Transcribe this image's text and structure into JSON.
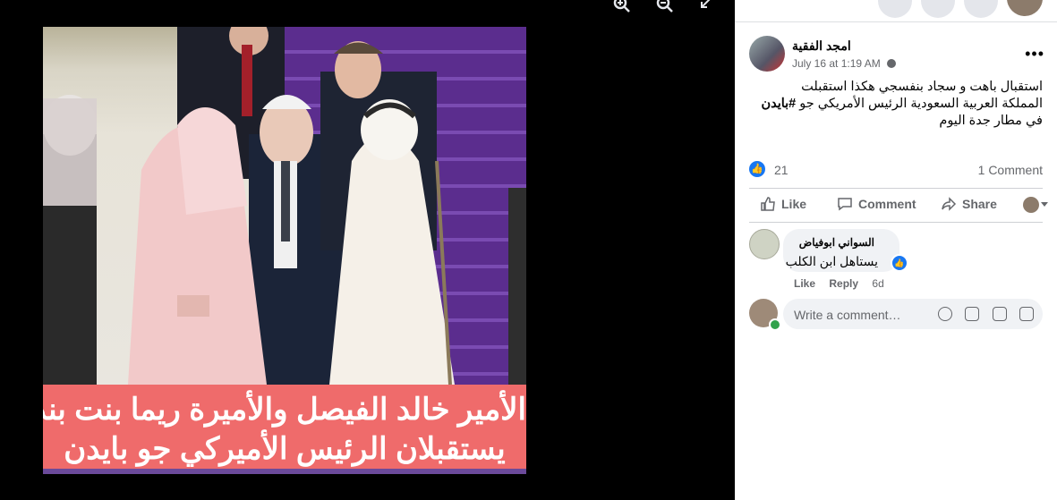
{
  "viewer": {
    "caption_line1": "الأمير خالد الفيصل والأميرة ريما بنت بندر",
    "caption_line2": "يستقبلان الرئيس الأميركي جو بايدن",
    "icons": [
      "zoom-in-icon",
      "zoom-out-icon",
      "expand-icon"
    ]
  },
  "post": {
    "author": "امجد الفقية",
    "timestamp": "July 16 at 1:19 AM",
    "more": "•••",
    "text_line1": "استقبال باهت و سجاد بنفسجي هكذا استقبلت",
    "text_line2_prefix": "المملكة العربية السعودية الرئيس الأمريكي جو ",
    "text_hashtag": "#بايدن",
    "text_line3": "في مطار جدة اليوم",
    "like_count": "21",
    "comment_count": "1 Comment"
  },
  "actions": {
    "like": "Like",
    "comment": "Comment",
    "share": "Share"
  },
  "comment": {
    "author": "السواني ابوفياض",
    "text": "يستاهل ابن الكلب",
    "like_label": "Like",
    "reply_label": "Reply",
    "age": "6d"
  },
  "composer": {
    "placeholder": "Write a comment…"
  },
  "colors": {
    "accent": "#1877f2",
    "caption_bg": "#ef6b6b",
    "carpet": "#5b2d8e"
  }
}
